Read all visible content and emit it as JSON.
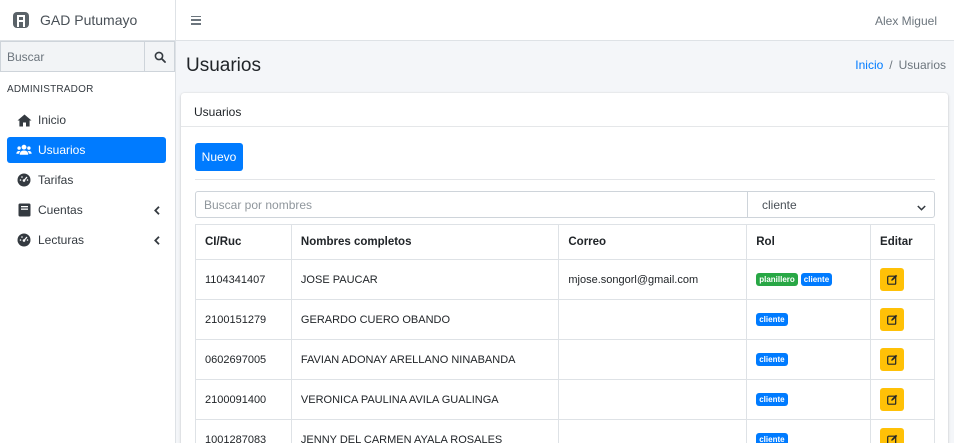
{
  "app": {
    "brand": "GAD Putumayo",
    "user": "Alex Miguel"
  },
  "colors": {
    "primary": "#007bff",
    "warning": "#ffc107",
    "success": "#28a745"
  },
  "sidebar": {
    "search_placeholder": "Buscar",
    "section_header": "ADMINISTRADOR",
    "items": [
      {
        "label": "Inicio",
        "icon": "home-icon",
        "active": false,
        "has_children": false
      },
      {
        "label": "Usuarios",
        "icon": "users-icon",
        "active": true,
        "has_children": false
      },
      {
        "label": "Tarifas",
        "icon": "tachometer-icon",
        "active": false,
        "has_children": false
      },
      {
        "label": "Cuentas",
        "icon": "book-icon",
        "active": false,
        "has_children": true
      },
      {
        "label": "Lecturas",
        "icon": "tachometer-icon",
        "active": false,
        "has_children": true
      }
    ]
  },
  "header": {
    "title": "Usuarios",
    "breadcrumb": [
      "Inicio",
      "Usuarios"
    ]
  },
  "card": {
    "title": "Usuarios",
    "new_button": "Nuevo",
    "filter_placeholder": "Buscar por nombres",
    "role_filter": "cliente"
  },
  "table": {
    "columns": [
      "CI/Ruc",
      "Nombres completos",
      "Correo",
      "Rol",
      "Editar"
    ],
    "rows": [
      {
        "ci": "1104341407",
        "name": "JOSE PAUCAR",
        "email": "mjose.songorl@gmail.com",
        "roles": [
          "planillero",
          "cliente"
        ]
      },
      {
        "ci": "2100151279",
        "name": "GERARDO CUERO OBANDO",
        "email": "",
        "roles": [
          "cliente"
        ]
      },
      {
        "ci": "0602697005",
        "name": "FAVIAN ADONAY ARELLANO NINABANDA",
        "email": "",
        "roles": [
          "cliente"
        ]
      },
      {
        "ci": "2100091400",
        "name": "VERONICA PAULINA AVILA GUALINGA",
        "email": "",
        "roles": [
          "cliente"
        ]
      },
      {
        "ci": "1001287083",
        "name": "JENNY DEL CARMEN AYALA ROSALES",
        "email": "",
        "roles": [
          "cliente"
        ]
      }
    ]
  }
}
